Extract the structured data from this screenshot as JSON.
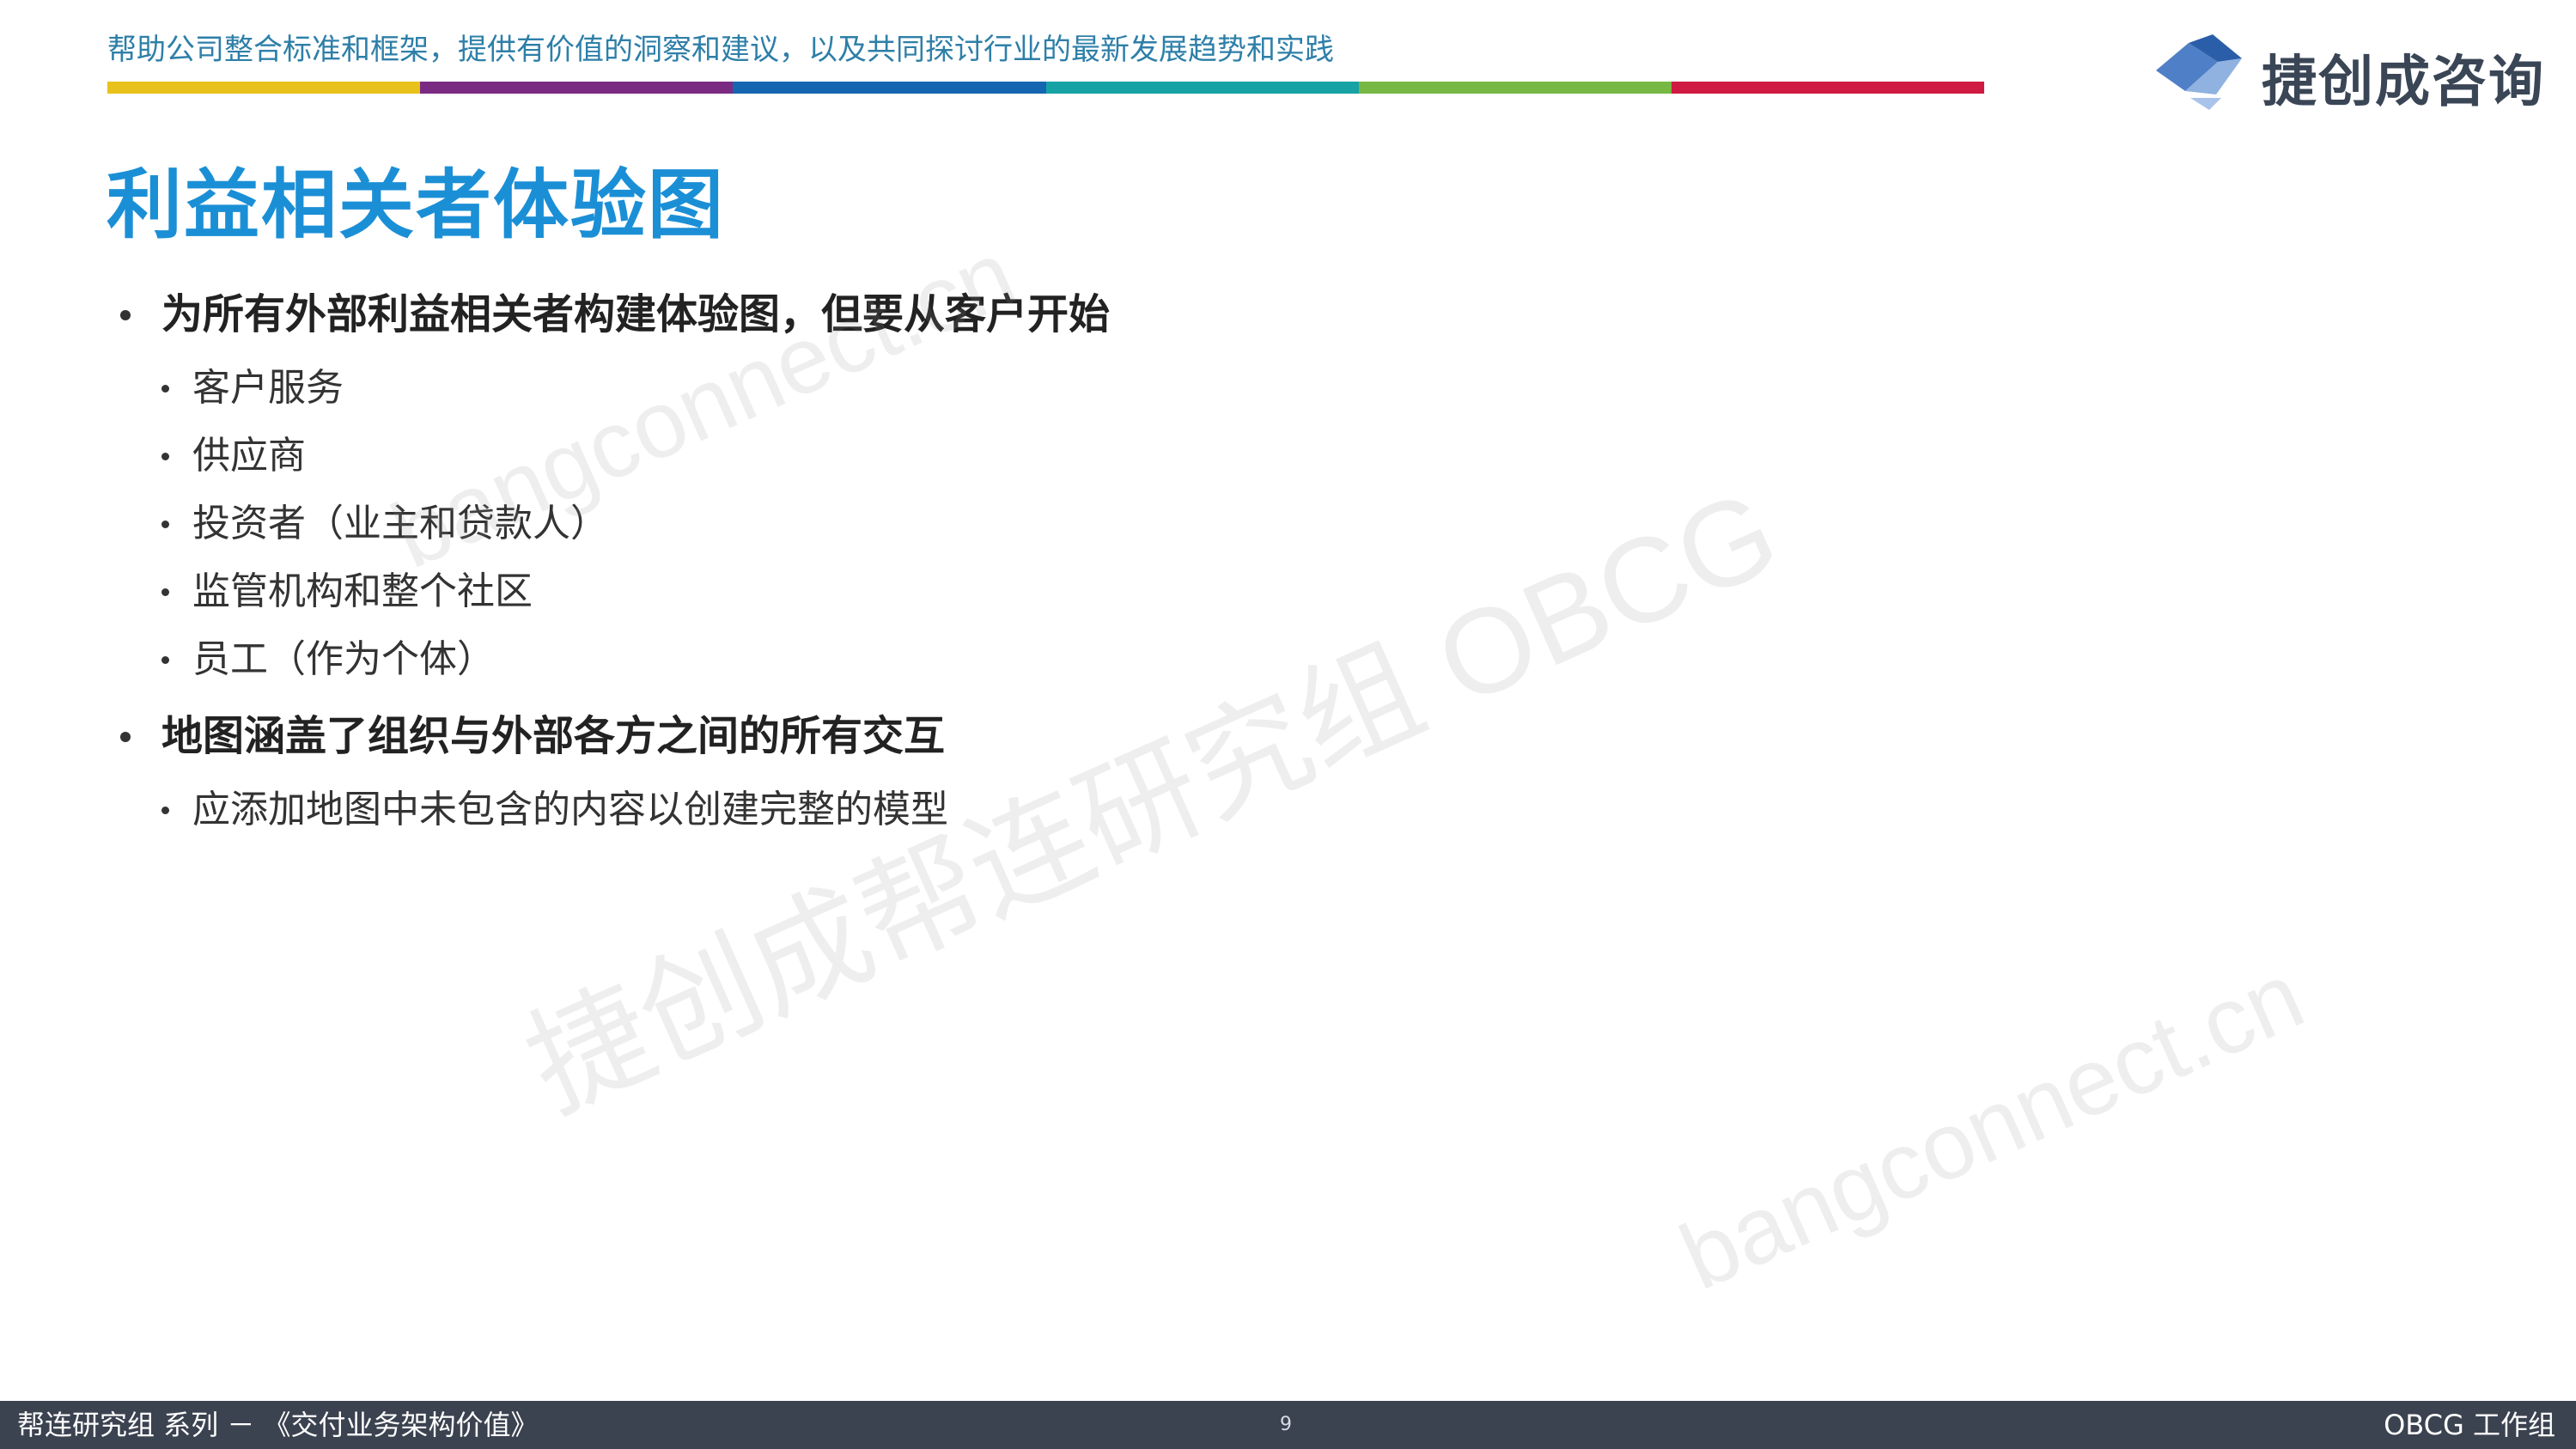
{
  "header": {
    "tagline": "帮助公司整合标准和框架，提供有价值的洞察和建议，以及共同探讨行业的最新发展趋势和实践",
    "bar_colors": [
      "#e8c21a",
      "#7b2a82",
      "#1466b0",
      "#17a3a6",
      "#76b843",
      "#cf1b42"
    ],
    "logo_text": "捷创成咨询",
    "logo_icon": "cube-logo-icon"
  },
  "title": "利益相关者体验图",
  "bullets": [
    {
      "text": "为所有外部利益相关者构建体验图，但要从客户开始",
      "children": [
        "客户服务",
        "供应商",
        "投资者（业主和贷款人）",
        "监管机构和整个社区",
        "员工（作为个体）"
      ]
    },
    {
      "text": "地图涵盖了组织与外部各方之间的所有交互",
      "children": [
        "应添加地图中未包含的内容以创建完整的模型"
      ]
    }
  ],
  "watermarks": [
    "bangconnect.cn",
    "捷创成帮连研究组 OBCG",
    "bangconnect.cn"
  ],
  "footer": {
    "left": "帮连研究组 系列 － 《交付业务架构价值》",
    "page_number": "9",
    "right": "OBCG 工作组"
  },
  "colors": {
    "title": "#1b8fd6",
    "tagline": "#2e7fa8",
    "footer_bg": "#3b4250"
  }
}
